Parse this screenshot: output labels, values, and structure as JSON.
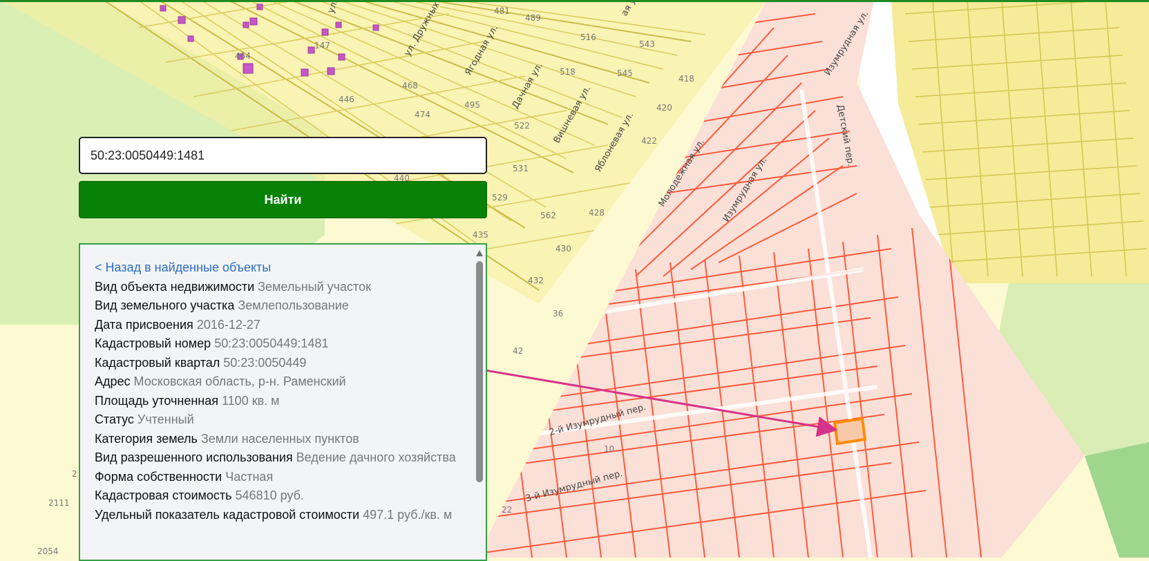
{
  "search": {
    "value": "50:23:0050449:1481",
    "button_label": "Найти"
  },
  "details": {
    "back_label": "< Назад в найденные объекты",
    "rows": [
      {
        "label": "Вид объекта недвижимости",
        "value": "Земельный участок"
      },
      {
        "label": "Вид земельного участка",
        "value": "Землепользование"
      },
      {
        "label": "Дата присвоения",
        "value": "2016-12-27"
      },
      {
        "label": "Кадастровый номер",
        "value": "50:23:0050449:1481"
      },
      {
        "label": "Кадастровый квартал",
        "value": "50:23:0050449"
      },
      {
        "label": "Адрес",
        "value": "Московская область, р-н. Раменский"
      },
      {
        "label": "Площадь уточненная",
        "value": "1100 кв. м"
      },
      {
        "label": "Статус",
        "value": "Учтенный"
      },
      {
        "label": "Категория земель",
        "value": "Земли населенных пунктов"
      },
      {
        "label": "Вид разрешенного использования",
        "value": "Ведение дачного хозяйства"
      },
      {
        "label": "Форма собственности",
        "value": "Частная"
      },
      {
        "label": "Кадастровая стоимость",
        "value": "546810 руб."
      },
      {
        "label": "Удельный показатель кадастровой стоимости",
        "value": "497.1 руб./кв. м"
      }
    ]
  },
  "map": {
    "colors": {
      "background": "#fdf9d2",
      "yellow_parcel": "#f2e88a",
      "red_parcel": "#ff5a3c",
      "red_fill": "#fbe0d8",
      "green": "#d7eeb2",
      "highlight": "#ff8c00",
      "arrow": "#d6338a",
      "accent": "#078107"
    },
    "street_labels": [
      "ул. Дружных С",
      "Ягодная ул.",
      "Дачная ул.",
      "Вишневая ул.",
      "Яблоневая ул.",
      "Молодежная ул.",
      "Изумрудная ул.",
      "Изумрудная ул.",
      "Детский пер.",
      "2-й Изумрудный пер.",
      "3-й Изумрудный пер.",
      "ул.",
      "ая ул."
    ],
    "parcel_numbers": [
      "481",
      "489",
      "516",
      "543",
      "147",
      "464",
      "446",
      "468",
      "474",
      "495",
      "518",
      "545",
      "418",
      "420",
      "522",
      "422",
      "531",
      "440",
      "529",
      "562",
      "428",
      "435",
      "430",
      "432",
      "36",
      "42",
      "10",
      "22",
      "2111",
      "2054",
      "2"
    ]
  }
}
